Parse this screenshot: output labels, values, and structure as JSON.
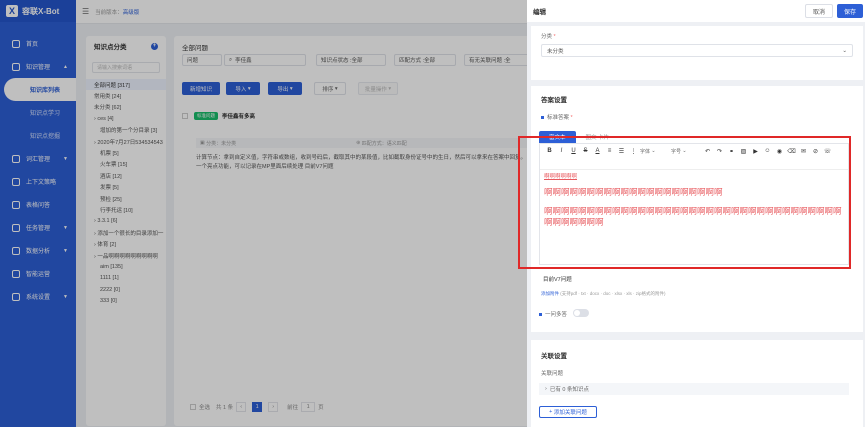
{
  "app": {
    "name": "容联X-Bot",
    "logo_letter": "X"
  },
  "topbar": {
    "version_label": "当前版本：",
    "version_value": "高级版"
  },
  "sidebar": {
    "items": [
      {
        "label": "首页"
      },
      {
        "label": "知识管理",
        "caret": "▲"
      },
      {
        "label": "词汇管理",
        "caret": "▼"
      },
      {
        "label": "上下文策略"
      },
      {
        "label": "表格问答"
      },
      {
        "label": "任务管理",
        "caret": "▼"
      },
      {
        "label": "数据分析",
        "caret": "▼"
      },
      {
        "label": "智能运营"
      },
      {
        "label": "系统设置",
        "caret": "▼"
      }
    ],
    "subitems": [
      {
        "label": "知识库列表"
      },
      {
        "label": "知识点学习"
      },
      {
        "label": "知识点挖掘"
      }
    ]
  },
  "category": {
    "title": "知识点分类",
    "search_placeholder": "请输入搜索词语",
    "items": [
      {
        "label": "全部问题 [317]"
      },
      {
        "label": "常用类 [24]"
      },
      {
        "label": "未分类 [62]"
      },
      {
        "label": "› ces [4]"
      },
      {
        "label": "增加的第一个分目录 [3]"
      },
      {
        "label": "› 2020年7月27日534534543"
      },
      {
        "label": "机票 [5]"
      },
      {
        "label": "火车票 [15]"
      },
      {
        "label": "酒店 [12]"
      },
      {
        "label": "发票 [5]"
      },
      {
        "label": "预检 [25]"
      },
      {
        "label": "行李托运 [10]"
      },
      {
        "label": "› 3.3.1 [6]"
      },
      {
        "label": "› 添加一个很长的目录添加一"
      },
      {
        "label": "› 体育 [2]"
      },
      {
        "label": "› 一品啊啊啊啊啊啊啊啊啊"
      },
      {
        "label": "aim [135]"
      },
      {
        "label": "1111 [1]"
      },
      {
        "label": "2222 [0]"
      },
      {
        "label": "333 [0]"
      }
    ]
  },
  "main": {
    "title": "全部问题",
    "filters": {
      "type": "问题",
      "keyword": "李佳鑫",
      "status": "知识点状态 :全部",
      "match": "匹配方式 :全部",
      "related": "有无关联问题 :全"
    },
    "buttons": {
      "add": "新增知识",
      "import": "导入",
      "export": "导出",
      "sort": "排序",
      "batch": "批量操作"
    },
    "question": {
      "tag": "标准问题",
      "title": "李佳鑫有多高",
      "meta_category": "分类：未分类",
      "meta_match": "匹配方式：语义匹配",
      "answer": "计算节点：拿到自定义值，字符串或数组，收到号码后，截取其中的某段值，比如截取身份证号中的生日，然后可以拿来在答案中回复。一个亮点功能，可以记录在MP里面后续处理  目前V7问题"
    },
    "pager": {
      "select_all": "全选",
      "total": "共 1 条",
      "current": "1",
      "goto": "前往",
      "page": "页",
      "page_input": "1"
    }
  },
  "drawer": {
    "title": "编辑",
    "cancel": "取消",
    "save": "保存",
    "category_label": "分类",
    "category_value": "未分类",
    "answer_section": "答案设置",
    "std_answer_label": "标准答案",
    "tab_text": "富文本",
    "tab_other": "图文 卡片",
    "toolbar": {
      "font": "字体",
      "size": "字号"
    },
    "editor": {
      "line_small": "啊啊啊啊啊啊",
      "line_big1": "啊啊啊啊啊啊啊啊啊啊啊啊啊啊啊啊啊啊啊啊啊",
      "line_big2": "啊啊啊啊啊啊啊啊啊啊啊啊啊啊啊啊啊啊啊啊啊啊啊啊啊啊啊啊啊啊啊啊啊啊啊啊啊啊啊啊啊啊"
    },
    "v7_question": "目前V7问题",
    "attach_link": "添加附件",
    "attach_hint": "(支持pdf · txt · docx · doc · xlsx · xls · zip格式的附件)",
    "multi_answer": "一问多答",
    "relation_section": "关联设置",
    "related_label": "关联问题",
    "related_count": "已有 0 条知识点",
    "add_related": "添加关联问题"
  }
}
